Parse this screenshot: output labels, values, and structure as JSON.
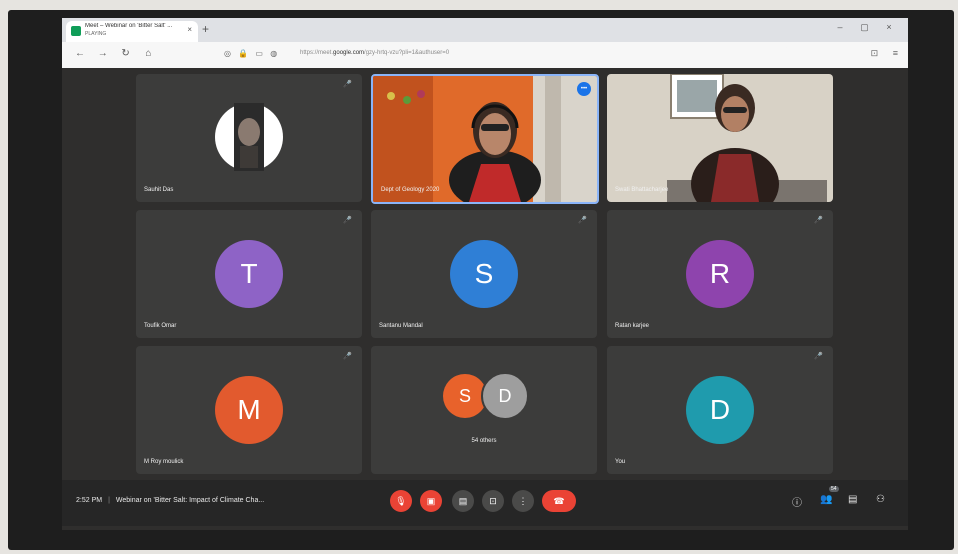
{
  "browser": {
    "tab_title": "Meet – Webinar on 'Bitter Salt' ...",
    "tab_subtitle": "PLAYING",
    "tab_close": "×",
    "new_tab": "+",
    "window_controls": {
      "minimize": "–",
      "maximize": "▢",
      "close": "×"
    },
    "url_prefix": "https://meet.",
    "url_domain": "google.com",
    "url_path": "/gzy-hrtq-vzu?pli=1&authuser=0"
  },
  "meet": {
    "tiles": [
      {
        "name": "Sauhit Das",
        "type": "photo"
      },
      {
        "name": "Dept of Geology 2020",
        "type": "video",
        "active": true
      },
      {
        "name": "Swati Bhattacharjee",
        "type": "video"
      },
      {
        "name": "Toufik Omar",
        "initial": "T",
        "color": "#8e63c6"
      },
      {
        "name": "Santanu Mandal",
        "initial": "S",
        "color": "#2f7fd6"
      },
      {
        "name": "Ratan karjee",
        "initial": "R",
        "color": "#8e44ad"
      },
      {
        "name": "M Roy moulick",
        "initial": "M",
        "color": "#e25a2e"
      },
      {
        "name": "54 others",
        "initial_a": "S",
        "color_a": "#e8622b",
        "initial_b": "D",
        "color_b": "#9e9e9e"
      },
      {
        "name": "You",
        "initial": "D",
        "color": "#1f9bad"
      }
    ],
    "mute_icon": "🎤"
  },
  "controlbar": {
    "time": "2:52 PM",
    "separator": "|",
    "meeting_title": "Webinar on 'Bitter Salt: Impact of Climate Cha...",
    "participants_count": "54"
  },
  "colors": {
    "meet_bg": "#2f2e2d",
    "tile_bg": "#3c3c3b",
    "danger": "#ea4335",
    "active_border": "#8ab4f8"
  }
}
